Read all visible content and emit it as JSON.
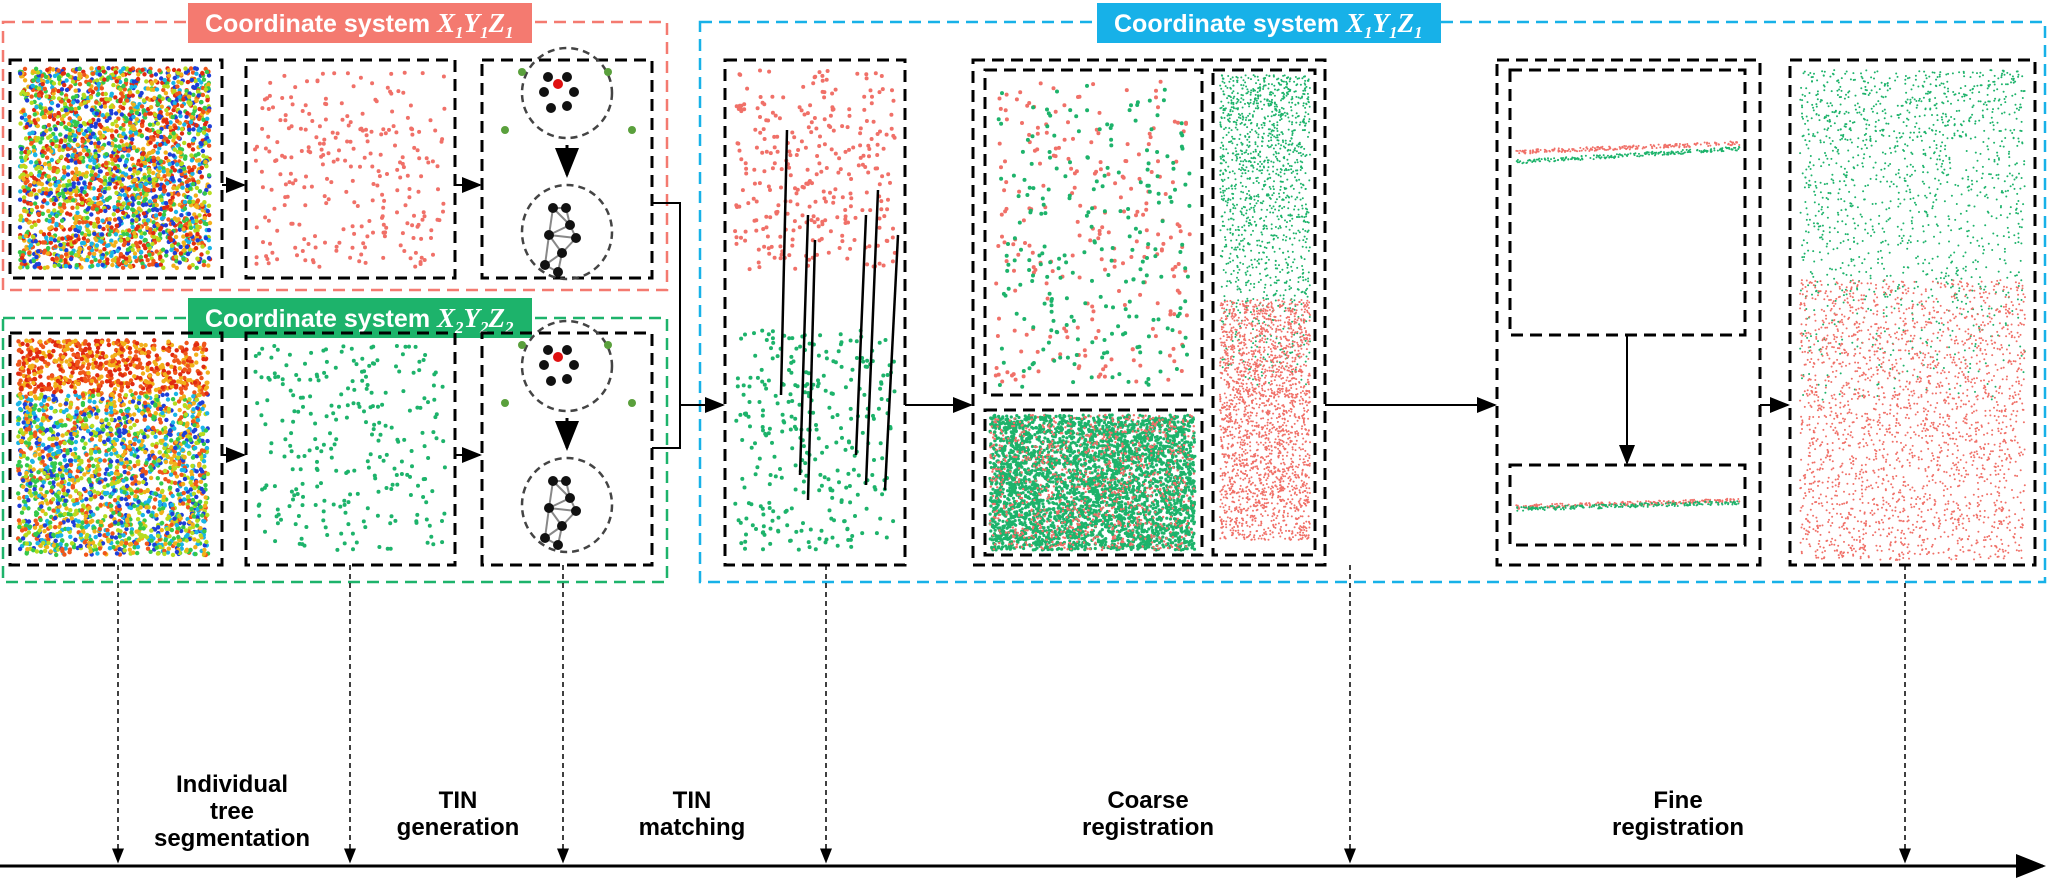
{
  "colors": {
    "red": "#f07068",
    "green": "#1db36b",
    "blue": "#1ab0e8",
    "black": "#000000"
  },
  "groups": [
    {
      "label": "Coordinate system ",
      "math": [
        "X",
        "1",
        "Y",
        "1",
        "Z",
        "1"
      ],
      "color": "#f47a70"
    },
    {
      "label": "Coordinate system ",
      "math": [
        "X",
        "2",
        "Y",
        "2",
        "Z",
        "2"
      ],
      "color": "#1db36b"
    },
    {
      "label": "Coordinate system ",
      "math": [
        "X",
        "1",
        "Y",
        "1",
        "Z",
        "1"
      ],
      "color": "#17b1e8"
    }
  ],
  "steps": [
    {
      "lines": [
        "Individual",
        "tree",
        "segmentation"
      ]
    },
    {
      "lines": [
        "TIN",
        "generation"
      ]
    },
    {
      "lines": [
        "TIN",
        "matching"
      ]
    },
    {
      "lines": [
        "Coarse",
        "registration"
      ]
    },
    {
      "lines": [
        "Fine",
        "registration"
      ]
    }
  ]
}
